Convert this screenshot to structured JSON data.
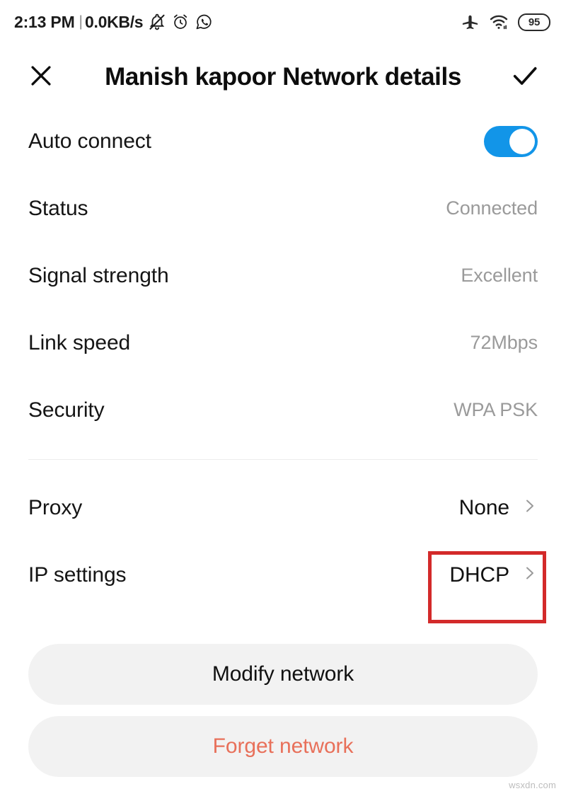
{
  "status_bar": {
    "clock": "2:13 PM",
    "separator": "|",
    "network_speed": "0.0KB/s",
    "left_icons": [
      "bell-muted-icon",
      "alarm-clock-icon",
      "whatsapp-icon"
    ],
    "right_icons": [
      "airplane-mode-icon",
      "wifi-icon"
    ],
    "battery_level": "95"
  },
  "app_bar": {
    "close_label": "close-icon",
    "title": "Manish kapoor Network details",
    "confirm_label": "check-icon"
  },
  "settings": {
    "auto_connect": {
      "label": "Auto connect",
      "toggle_on": true
    },
    "rows": [
      {
        "label": "Status",
        "value": "Connected"
      },
      {
        "label": "Signal strength",
        "value": "Excellent"
      },
      {
        "label": "Link speed",
        "value": "72Mbps"
      },
      {
        "label": "Security",
        "value": "WPA PSK"
      }
    ],
    "nav_rows": [
      {
        "label": "Proxy",
        "value": "None"
      },
      {
        "label": "IP settings",
        "value": "DHCP"
      }
    ]
  },
  "actions": {
    "modify": "Modify network",
    "forget": "Forget network"
  },
  "annotation": {
    "highlight_color": "#d32a2a",
    "highlights": "IP settings value DHCP"
  },
  "colors": {
    "accent_toggle": "#1295e8",
    "danger_text": "#e8705a",
    "button_bg": "#f2f2f2",
    "value_text": "#9a9a9a"
  },
  "watermark": "wsxdn.com"
}
